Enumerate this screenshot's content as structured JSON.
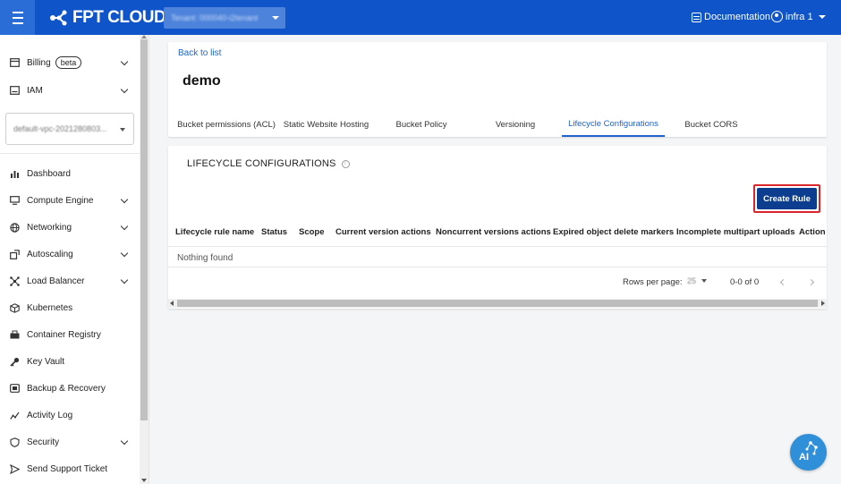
{
  "header": {
    "brand": "FPT CLOUD",
    "tenant_label": "Tenant: 000040-i2tenant",
    "documentation_label": "Documentation",
    "user_name": "infra 1"
  },
  "sidebar": {
    "billing": {
      "label": "Billing",
      "badge": "beta"
    },
    "iam_label": "IAM",
    "vpc_selector_value": "default-vpc-2021280803...",
    "items": [
      {
        "label": "Dashboard",
        "icon": "bar-chart-icon",
        "expandable": false
      },
      {
        "label": "Compute Engine",
        "icon": "monitor-icon",
        "expandable": true
      },
      {
        "label": "Networking",
        "icon": "globe-icon",
        "expandable": true
      },
      {
        "label": "Autoscaling",
        "icon": "autoscaling-icon",
        "expandable": true
      },
      {
        "label": "Load Balancer",
        "icon": "load-balancer-icon",
        "expandable": true
      },
      {
        "label": "Kubernetes",
        "icon": "cube-icon",
        "expandable": false
      },
      {
        "label": "Container Registry",
        "icon": "container-icon",
        "expandable": false
      },
      {
        "label": "Key Vault",
        "icon": "key-icon",
        "expandable": false
      },
      {
        "label": "Backup & Recovery",
        "icon": "backup-icon",
        "expandable": false
      },
      {
        "label": "Activity Log",
        "icon": "activity-icon",
        "expandable": false
      },
      {
        "label": "Security",
        "icon": "shield-icon",
        "expandable": true
      },
      {
        "label": "Send Support Ticket",
        "icon": "send-icon",
        "expandable": false
      }
    ]
  },
  "page": {
    "back_label": "Back to list",
    "title": "demo",
    "tabs": [
      {
        "label": "Bucket permissions (ACL)",
        "active": false
      },
      {
        "label": "Static Website Hosting",
        "active": false
      },
      {
        "label": "Bucket Policy",
        "active": false
      },
      {
        "label": "Versioning",
        "active": false
      },
      {
        "label": "Lifecycle Configurations",
        "active": true
      },
      {
        "label": "Bucket CORS",
        "active": false
      }
    ]
  },
  "lifecycle": {
    "section_title": "LIFECYCLE CONFIGURATIONS",
    "create_label": "Create Rule",
    "columns": [
      "Lifecycle rule name",
      "Status",
      "Scope",
      "Current version actions",
      "Noncurrent versions actions",
      "Expired object delete markers",
      "Incomplete multipart uploads",
      "Action"
    ],
    "empty_text": "Nothing found",
    "rows_per_page_label": "Rows per page:",
    "rows_per_page_value": "25",
    "page_range": "0-0 of 0"
  },
  "colors": {
    "topbar": "#0f54c9",
    "accent": "#1e63c9",
    "primary_button": "#0c3d8f",
    "highlight_border": "#d9262c"
  },
  "ai_button_label": "AI"
}
